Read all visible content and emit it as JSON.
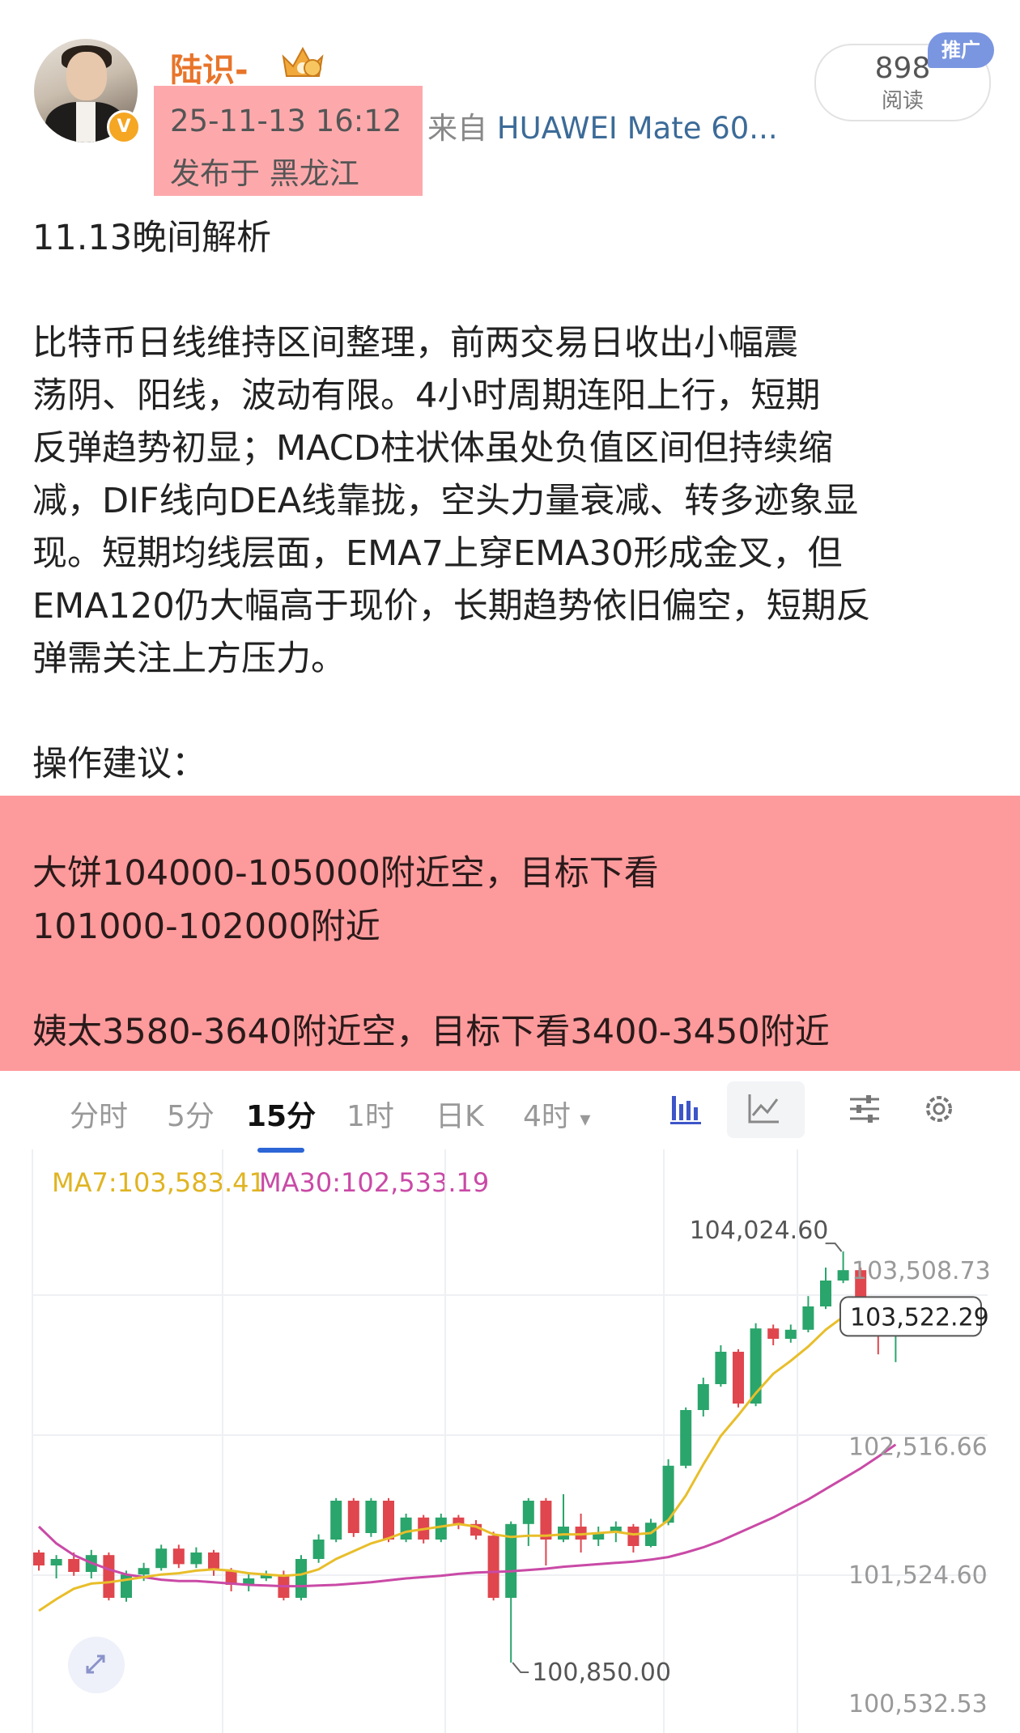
{
  "post": {
    "author_name": "陆识-",
    "verified_badge": "V",
    "timestamp": "25-11-13 16:12",
    "location": "发布于 黑龙江",
    "source_prefix": "来自",
    "source_device": "HUAWEI Mate 60...",
    "reads_count": "898",
    "reads_label": "阅读",
    "ad_badge": "推广",
    "title": "11.13晚间解析",
    "body_lines": [
      "比特币日线维持区间整理，前两交易日收出小幅震",
      "荡阴、阳线，波动有限。4小时周期连阳上行，短期",
      "反弹趋势初显；MACD柱状体虽处负值区间但持续缩",
      "减，DIF线向DEA线靠拢，空头力量衰减、转多迹象显",
      "现。短期均线层面，EMA7上穿EMA30形成金叉，但",
      "EMA120仍大幅高于现价，长期趋势依旧偏空，短期反",
      "弹需关注上方压力。"
    ],
    "ops_heading": "操作建议：",
    "ops_lines": [
      "大饼104000-105000附近空，目标下看",
      "101000-102000附近",
      "姨太3580-3640附近空，目标下看3400-3450附近"
    ]
  },
  "chart_toolbar": {
    "tabs": [
      "分时",
      "5分",
      "15分",
      "1时",
      "日K",
      "4时"
    ],
    "active_tab": "15分",
    "more_arrow": "▾",
    "icons": [
      "bar-chart-icon",
      "line-chart-icon",
      "settings-sliders-icon",
      "gear-icon"
    ]
  },
  "chart_data": {
    "type": "candlestick",
    "legend": {
      "ma7": "MA7:103,583.41",
      "ma30": "MA30:102,533.19"
    },
    "colors": {
      "up": "#2aa56b",
      "down": "#e0464d",
      "ma7": "#e8be2a",
      "ma30": "#c94aa6"
    },
    "price_labels": [
      "102,516.66",
      "101,524.60",
      "100,532.53"
    ],
    "price_label_values": [
      102516.66,
      101524.6,
      100532.53
    ],
    "top_partial_label": "103,508.73",
    "current_price": "103,522.29",
    "current_price_value": 103522.29,
    "high_label": "104,024.60",
    "high_value": 104024.6,
    "low_label": "100,850.00",
    "low_value": 100850.0,
    "ylim": [
      100450,
      104450
    ],
    "candles": [
      [
        101700,
        101600,
        101720,
        101560
      ],
      [
        101600,
        101650,
        101680,
        101500
      ],
      [
        101650,
        101550,
        101700,
        101520
      ],
      [
        101550,
        101680,
        101720,
        101500
      ],
      [
        101680,
        101350,
        101700,
        101330
      ],
      [
        101350,
        101530,
        101560,
        101320
      ],
      [
        101530,
        101580,
        101620,
        101480
      ],
      [
        101580,
        101730,
        101760,
        101560
      ],
      [
        101730,
        101610,
        101760,
        101580
      ],
      [
        101610,
        101700,
        101740,
        101580
      ],
      [
        101700,
        101560,
        101720,
        101520
      ],
      [
        101560,
        101450,
        101580,
        101400
      ],
      [
        101450,
        101500,
        101540,
        101400
      ],
      [
        101500,
        101530,
        101560,
        101480
      ],
      [
        101530,
        101350,
        101560,
        101330
      ],
      [
        101350,
        101650,
        101680,
        101330
      ],
      [
        101650,
        101800,
        101840,
        101620
      ],
      [
        101800,
        102100,
        102120,
        101780
      ],
      [
        102100,
        101850,
        102120,
        101820
      ],
      [
        101850,
        102100,
        102120,
        101820
      ],
      [
        102100,
        101800,
        102120,
        101780
      ],
      [
        101800,
        101970,
        102000,
        101780
      ],
      [
        101970,
        101800,
        101990,
        101770
      ],
      [
        101800,
        101970,
        102000,
        101780
      ],
      [
        101970,
        101920,
        101990,
        101880
      ],
      [
        101920,
        101830,
        101950,
        101800
      ],
      [
        101830,
        101350,
        101860,
        101330
      ],
      [
        101350,
        101920,
        101940,
        101050
      ],
      [
        101920,
        102100,
        102120,
        101750
      ],
      [
        102100,
        101800,
        102120,
        101600
      ],
      [
        101800,
        101900,
        102150,
        101780
      ],
      [
        101900,
        101800,
        102000,
        101700
      ],
      [
        101800,
        101850,
        101900,
        101750
      ],
      [
        101850,
        101900,
        101940,
        101780
      ],
      [
        101900,
        101750,
        101920,
        101700
      ],
      [
        101750,
        101930,
        101960,
        101740
      ],
      [
        101930,
        102370,
        102420,
        101910
      ],
      [
        102370,
        102800,
        102820,
        102350
      ],
      [
        102800,
        103000,
        103050,
        102750
      ],
      [
        103000,
        103250,
        103300,
        102980
      ],
      [
        103250,
        102850,
        103270,
        102820
      ],
      [
        102850,
        103430,
        103470,
        102830
      ],
      [
        103430,
        103350,
        103460,
        103300
      ],
      [
        103350,
        103420,
        103460,
        103320
      ],
      [
        103420,
        103600,
        103680,
        103400
      ],
      [
        103600,
        103800,
        103900,
        103580
      ],
      [
        103800,
        103880,
        104024.6,
        103780
      ],
      [
        103880,
        103480,
        103900,
        103450
      ],
      [
        103480,
        103420,
        103520,
        103230
      ],
      [
        103420,
        103522.29,
        103560,
        103170
      ]
    ],
    "ma7": [
      101250,
      101340,
      101420,
      101460,
      101470,
      101490,
      101510,
      101530,
      101540,
      101560,
      101570,
      101560,
      101540,
      101530,
      101520,
      101530,
      101570,
      101650,
      101710,
      101770,
      101810,
      101860,
      101880,
      101900,
      101920,
      101900,
      101840,
      101820,
      101830,
      101830,
      101840,
      101840,
      101850,
      101860,
      101840,
      101850,
      101950,
      102140,
      102380,
      102600,
      102760,
      102930,
      103080,
      103180,
      103290,
      103420,
      103520,
      103560,
      103580,
      103583.41
    ],
    "ma30": [
      101900,
      101770,
      101680,
      101620,
      101570,
      101530,
      101510,
      101490,
      101480,
      101480,
      101470,
      101460,
      101450,
      101445,
      101440,
      101440,
      101445,
      101450,
      101460,
      101470,
      101485,
      101500,
      101510,
      101520,
      101535,
      101545,
      101550,
      101555,
      101565,
      101575,
      101590,
      101600,
      101610,
      101620,
      101630,
      101645,
      101665,
      101700,
      101740,
      101790,
      101850,
      101910,
      101970,
      102040,
      102110,
      102190,
      102270,
      102350,
      102440,
      102533.19
    ]
  }
}
